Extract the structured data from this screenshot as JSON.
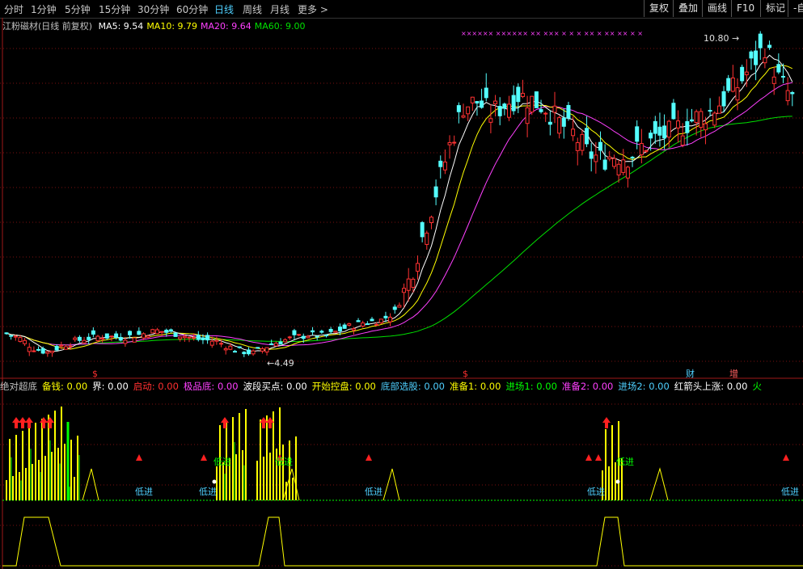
{
  "toolbar": {
    "periods": [
      "分时",
      "1分钟",
      "5分钟",
      "15分钟",
      "30分钟",
      "60分钟",
      "日线",
      "周线",
      "月线",
      "更多 >"
    ],
    "active_period": "日线",
    "buttons": [
      "复权",
      "叠加",
      "画线",
      "F10",
      "标记",
      "-自"
    ]
  },
  "main_chart": {
    "title": "江粉磁材(日线 前复权)",
    "ma": [
      {
        "label": "MA5: 9.54",
        "color": "#ffffff"
      },
      {
        "label": "MA10: 9.79",
        "color": "#ffff00"
      },
      {
        "label": "MA20: 9.64",
        "color": "#ff40ff"
      },
      {
        "label": "MA60: 9.00",
        "color": "#00e000"
      }
    ],
    "high_label": "10.80",
    "low_label": "4.49",
    "markers": [
      {
        "text": "$",
        "color": "#ff3030"
      },
      {
        "text": "$",
        "color": "#ff3030"
      },
      {
        "text": "财",
        "color": "#4fd0ff"
      },
      {
        "text": "增",
        "color": "#ff6060"
      }
    ],
    "top_marks": "×××××× ×××××× ×× ××× × × × ×× × ×× ×× × ×"
  },
  "indicator": {
    "legend": [
      {
        "text": "绝对超底",
        "color": "#c0c0c0"
      },
      {
        "text": "备钱: 0.00",
        "color": "#ffff00"
      },
      {
        "text": "界: 0.00",
        "color": "#ffffff"
      },
      {
        "text": "启动: 0.00",
        "color": "#ff3030"
      },
      {
        "text": "极品底: 0.00",
        "color": "#ff40ff"
      },
      {
        "text": "波段买点: 0.00",
        "color": "#ffffff"
      },
      {
        "text": "开始控盘: 0.00",
        "color": "#ffff00"
      },
      {
        "text": "底部选股: 0.00",
        "color": "#4fd0ff"
      },
      {
        "text": "准备1: 0.00",
        "color": "#ffff00"
      },
      {
        "text": "进场1: 0.00",
        "color": "#00ff00"
      },
      {
        "text": "准备2: 0.00",
        "color": "#ff40ff"
      },
      {
        "text": "进场2: 0.00",
        "color": "#4fd0ff"
      },
      {
        "text": "红箭头上涨: 0.00",
        "color": "#ffffff"
      },
      {
        "text": "火",
        "color": "#00ff00"
      }
    ],
    "signal_label": "低进",
    "signal_label_alt": "低进"
  },
  "colors": {
    "up": "#ff3232",
    "down": "#54ffff",
    "ma5": "#ffffff",
    "ma10": "#ffff00",
    "ma20": "#ff40ff",
    "ma60": "#00e000",
    "grid": "#7a1010"
  },
  "chart_data": {
    "type": "candlestick",
    "title": "江粉磁材(日线 前复权)",
    "price_path": [
      [
        0,
        8.4
      ],
      [
        3,
        8.0
      ],
      [
        6,
        7.3
      ],
      [
        9,
        7.0
      ],
      [
        13,
        7.6
      ],
      [
        17,
        8.0
      ],
      [
        21,
        8.2
      ],
      [
        25,
        8.1
      ],
      [
        29,
        8.3
      ],
      [
        33,
        8.6
      ],
      [
        37,
        8.4
      ],
      [
        41,
        8.0
      ],
      [
        46,
        7.8
      ],
      [
        50,
        7.2
      ],
      [
        54,
        6.9
      ],
      [
        58,
        7.6
      ],
      [
        62,
        8.0
      ],
      [
        66,
        8.3
      ],
      [
        70,
        8.2
      ],
      [
        74,
        8.8
      ],
      [
        78,
        9.2
      ],
      [
        82,
        9.4
      ],
      [
        85,
        10.0
      ],
      [
        88,
        12.3
      ],
      [
        91,
        15.6
      ],
      [
        94,
        19.0
      ],
      [
        97,
        22.5
      ],
      [
        100,
        25.5
      ],
      [
        103,
        25.8
      ],
      [
        106,
        24.9
      ],
      [
        109,
        25.6
      ],
      [
        112,
        26.3
      ],
      [
        115,
        25.9
      ],
      [
        118,
        25.4
      ],
      [
        121,
        24.2
      ],
      [
        124,
        23.4
      ],
      [
        127,
        22.0
      ],
      [
        130,
        21.5
      ],
      [
        133,
        21.8
      ],
      [
        136,
        21.7
      ],
      [
        139,
        22.4
      ],
      [
        142,
        23.0
      ],
      [
        145,
        23.4
      ],
      [
        148,
        24.0
      ],
      [
        151,
        24.6
      ],
      [
        154,
        25.0
      ],
      [
        157,
        26.0
      ],
      [
        160,
        27.0
      ],
      [
        163,
        28.5
      ],
      [
        166,
        30.0
      ],
      [
        169,
        27.5
      ],
      [
        172,
        26.0
      ]
    ],
    "labels": {
      "high": "10.80",
      "low": "4.49"
    },
    "ma_values": {
      "MA5": 9.54,
      "MA10": 9.79,
      "MA20": 9.64,
      "MA60": 9.0
    }
  }
}
